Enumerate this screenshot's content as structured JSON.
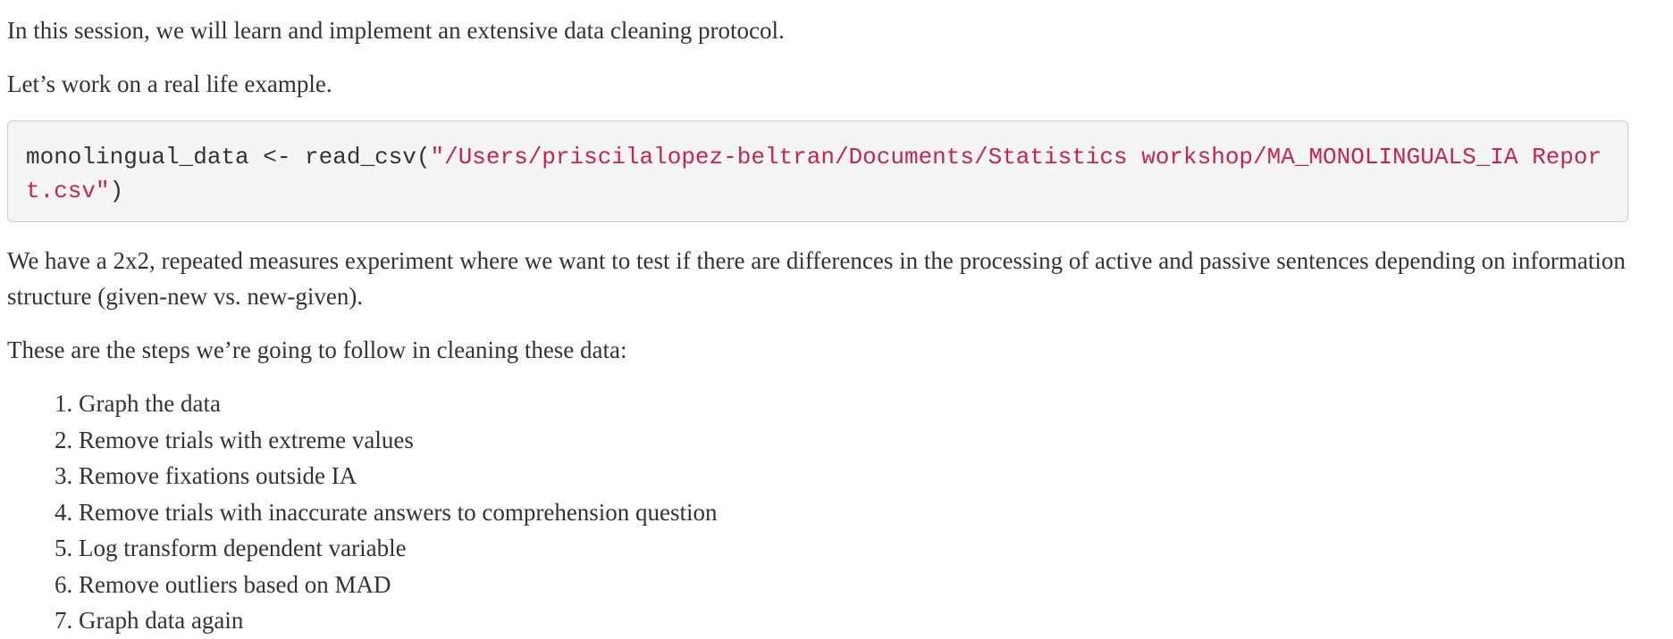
{
  "intro": "In this session, we will learn and implement an extensive data cleaning protocol.",
  "example_intro": "Let’s work on a real life example.",
  "code": {
    "prefix": "monolingual_data <- read_csv(",
    "string": "\"/Users/priscilalopez-beltran/Documents/Statistics workshop/MA_MONOLINGUALS_IA Report.csv\"",
    "suffix": ")"
  },
  "description": "We have a 2x2, repeated measures experiment where we want to test if there are differences in the processing of active and passive sentences depending on information structure (given-new vs. new-given).",
  "steps_intro": "These are the steps we’re going to follow in cleaning these data:",
  "steps": [
    "Graph the data",
    "Remove trials with extreme values",
    "Remove fixations outside IA",
    "Remove trials with inaccurate answers to comprehension question",
    "Log transform dependent variable",
    "Remove outliers based on MAD",
    "Graph data again"
  ],
  "colors": {
    "text": "#333333",
    "code_string": "#c7254e",
    "code_background": "#f5f5f5",
    "code_border": "#cccccc"
  }
}
